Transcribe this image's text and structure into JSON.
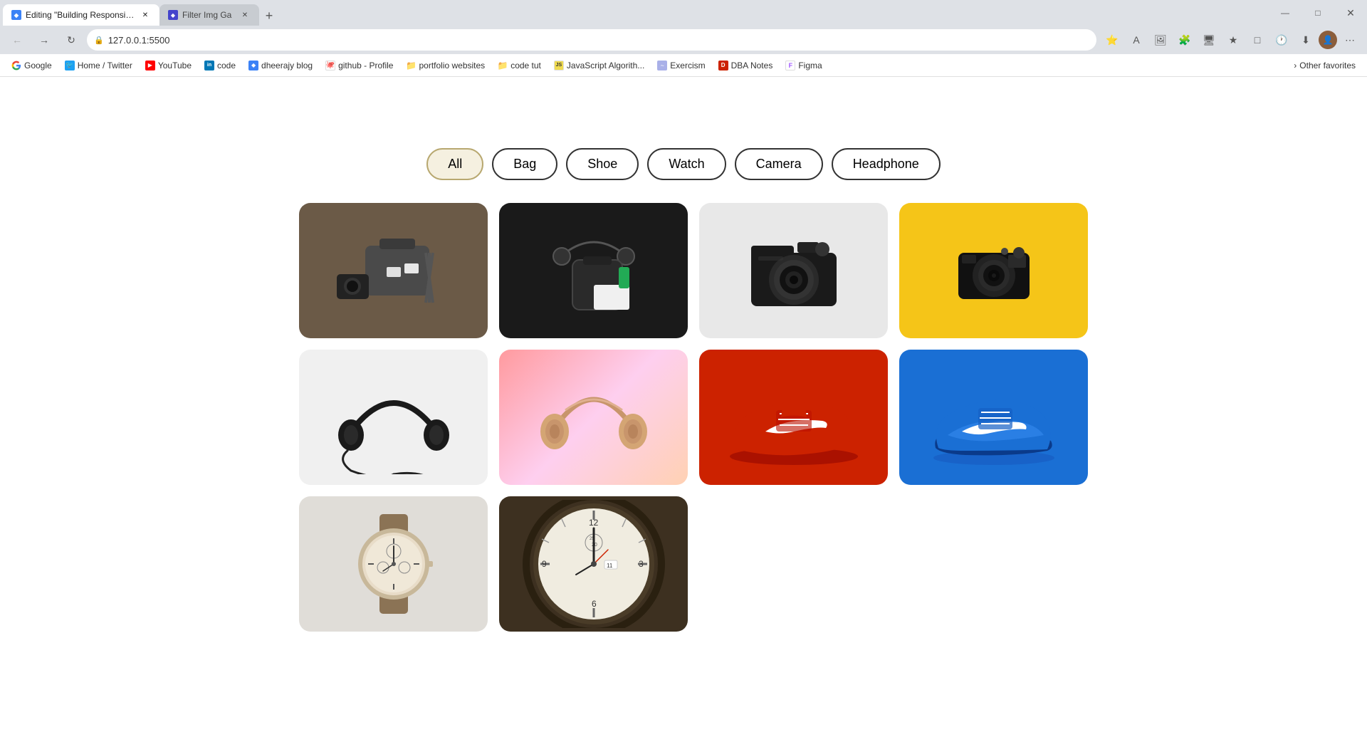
{
  "browser": {
    "tabs": [
      {
        "id": "tab1",
        "title": "Editing \"Building Responsive Filt...",
        "favicon_color": "#3b82f6",
        "active": true
      },
      {
        "id": "tab2",
        "title": "Filter Img Ga",
        "favicon_color": "#4444cc",
        "active": false
      }
    ],
    "new_tab_label": "+",
    "address": "127.0.0.1:5500",
    "window_buttons": [
      "—",
      "□",
      "✕"
    ]
  },
  "bookmarks": [
    {
      "id": "google",
      "label": "Google",
      "icon": "G",
      "icon_color": "#4285f4"
    },
    {
      "id": "twitter",
      "label": "Home / Twitter",
      "icon": "🐦",
      "icon_color": "#1da1f2"
    },
    {
      "id": "youtube",
      "label": "YouTube",
      "icon": "▶",
      "icon_color": "#ff0000"
    },
    {
      "id": "linkedin",
      "label": "code",
      "icon": "in",
      "icon_color": "#0077b5"
    },
    {
      "id": "dheerajblog",
      "label": "dheerajy blog",
      "icon": "◆",
      "icon_color": "#3b82f6"
    },
    {
      "id": "github",
      "label": "github - Profile",
      "icon": "⚙",
      "icon_color": "#333"
    },
    {
      "id": "portfolio",
      "label": "portfolio websites",
      "icon": "📁",
      "icon_color": "#f5a623"
    },
    {
      "id": "codetut",
      "label": "code tut",
      "icon": "📁",
      "icon_color": "#f5a623"
    },
    {
      "id": "jsalgo",
      "label": "JavaScript Algorith...",
      "icon": "JS",
      "icon_color": "#f0db4f"
    },
    {
      "id": "exercism",
      "label": "Exercism",
      "icon": "~",
      "icon_color": "#a9b0e8"
    },
    {
      "id": "dba",
      "label": "DBA Notes",
      "icon": "D",
      "icon_color": "#cc2200"
    },
    {
      "id": "figma",
      "label": "Figma",
      "icon": "F",
      "icon_color": "#a259ff"
    }
  ],
  "bookmarks_more": "Other favorites",
  "filters": [
    {
      "id": "all",
      "label": "All",
      "active": true
    },
    {
      "id": "bag",
      "label": "Bag",
      "active": false
    },
    {
      "id": "shoe",
      "label": "Shoe",
      "active": false
    },
    {
      "id": "watch",
      "label": "Watch",
      "active": false
    },
    {
      "id": "camera",
      "label": "Camera",
      "active": false
    },
    {
      "id": "headphone",
      "label": "Headphone",
      "active": false
    }
  ],
  "images": [
    {
      "id": "bag1",
      "category": "bag",
      "bg": "#6b5a47",
      "type": "bag-dark"
    },
    {
      "id": "bag2",
      "category": "bag",
      "bg": "#1a1a1a",
      "type": "bag-black"
    },
    {
      "id": "camera1",
      "category": "camera",
      "bg": "#e8e8e8",
      "type": "camera-white"
    },
    {
      "id": "camera2",
      "category": "camera",
      "bg": "#f5c518",
      "type": "camera-yellow"
    },
    {
      "id": "headphone1",
      "category": "headphone",
      "bg": "#f0f0f0",
      "type": "headphone-black"
    },
    {
      "id": "headphone2",
      "category": "headphone",
      "bg": "pink",
      "type": "headphone-pink"
    },
    {
      "id": "shoe1",
      "category": "shoe",
      "bg": "#cc2200",
      "type": "shoe-red"
    },
    {
      "id": "shoe2",
      "category": "shoe",
      "bg": "#1a6fd4",
      "type": "shoe-blue"
    },
    {
      "id": "watch1",
      "category": "watch",
      "bg": "#e0ddd8",
      "type": "watch-light"
    },
    {
      "id": "watch2",
      "category": "watch",
      "bg": "#3d3020",
      "type": "watch-dark"
    }
  ]
}
